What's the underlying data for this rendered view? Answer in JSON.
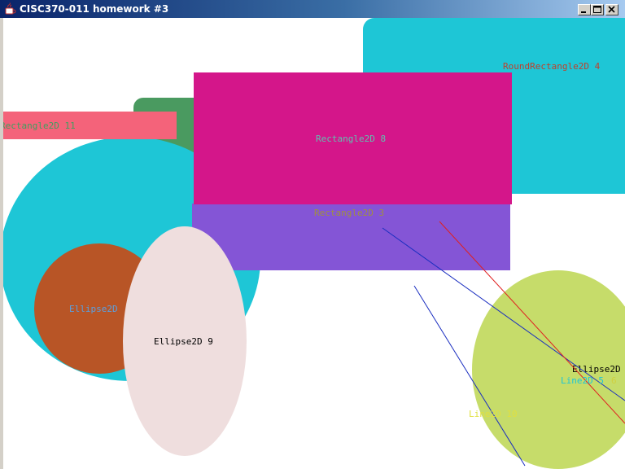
{
  "window": {
    "title": "CISC370-011 homework #3",
    "icon": "java-cup-icon",
    "controls": {
      "minimize": "minimize-icon",
      "maximize": "maximize-icon",
      "close": "close-icon"
    }
  },
  "canvas": {
    "background": "#ffffff",
    "shapes": {
      "round_rect_4": {
        "label": "RoundRectangle2D 4",
        "fill": "#1ec6d6",
        "label_color": "#c0402a"
      },
      "green_shape": {
        "fill": "#4a9a60"
      },
      "rect_11": {
        "label": "Rectangle2D 11",
        "fill": "#f4637a",
        "label_color": "#40a060"
      },
      "ellipse_cyan": {
        "fill": "#1ec6d6"
      },
      "rect_8": {
        "label": "Rectangle2D 8",
        "fill": "#d4168a",
        "label_color": "#60c0b0"
      },
      "rect_3": {
        "label": "Rectangle2D 3",
        "fill": "#8455d6",
        "label_color": "#a09040"
      },
      "ellipse_brown": {
        "label": "Ellipse2D",
        "fill": "#b85526",
        "label_color": "#5aa0e0"
      },
      "ellipse_9": {
        "label": "Ellipse2D 9",
        "fill": "#efdede",
        "label_color": "#000000"
      },
      "ellipse_green": {
        "label": "Ellipse2D",
        "fill": "#c6dc6a",
        "label_color": "#000000"
      },
      "line_5": {
        "label": "Line2D 5",
        "stroke": "#1a2ec0",
        "label_color": "#1ec6d6"
      },
      "line_6_label": {
        "label": "6",
        "label_color": "#d0d040"
      },
      "line_10": {
        "label": "Line2D 10",
        "stroke": "#1a2ec0",
        "label_color": "#e0e040"
      },
      "line_red": {
        "stroke": "#e02020"
      }
    }
  }
}
